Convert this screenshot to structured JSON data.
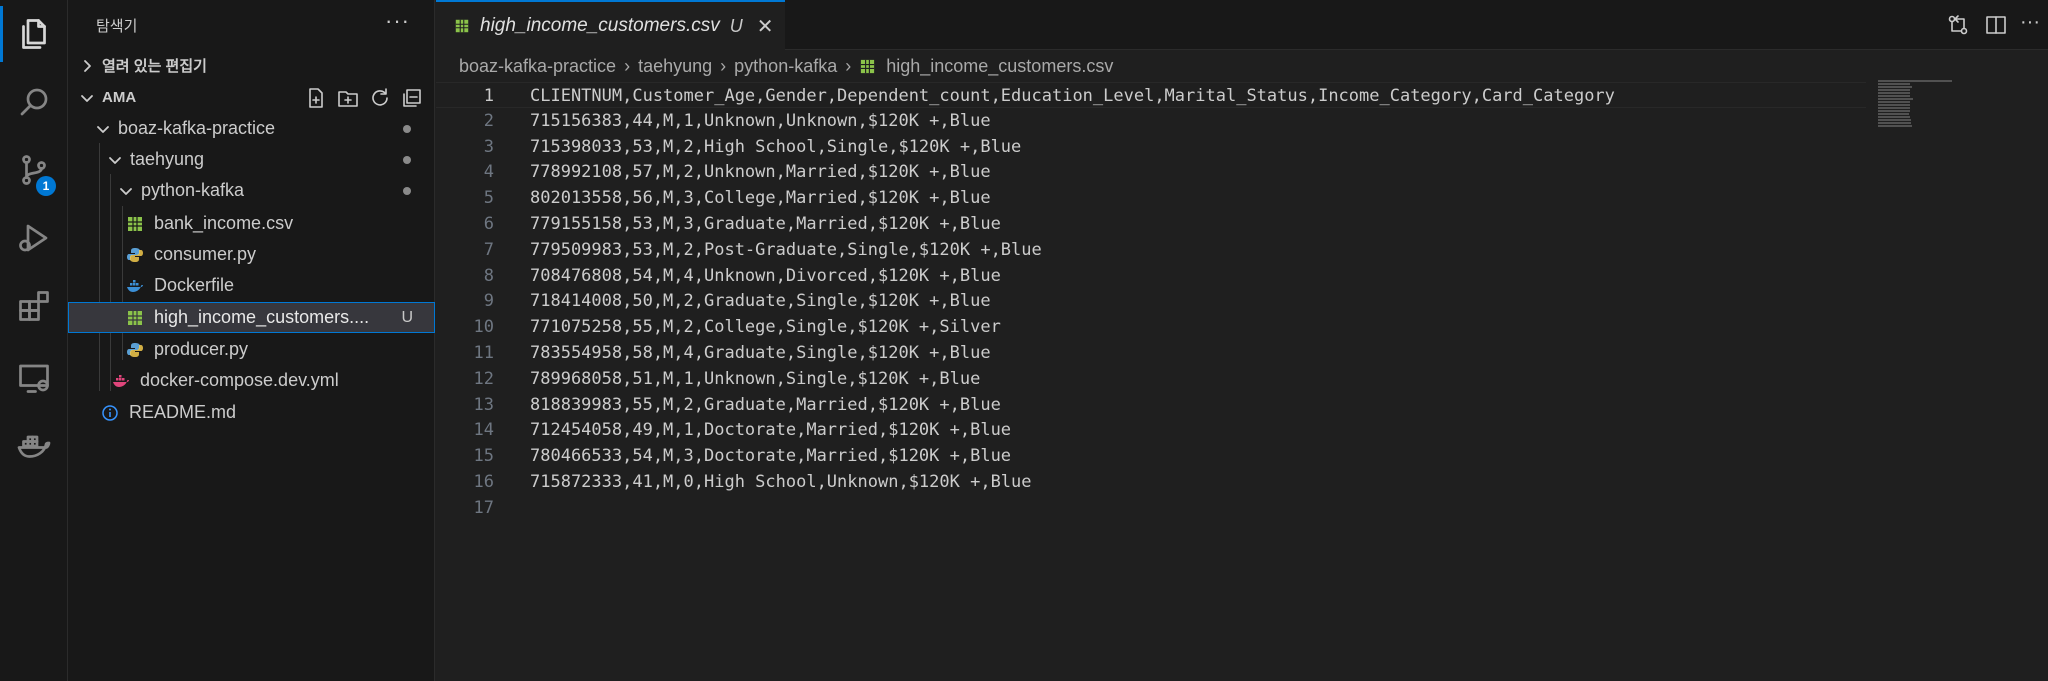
{
  "colors": {
    "accent": "#0078d4",
    "csv_icon": "#8bc34a",
    "python_icon": "#5a9fd4",
    "docker_icon": "#3b8fd6",
    "yaml_docker_icon": "#e0457b",
    "info_icon": "#3794ff"
  },
  "activity_bar": {
    "items": [
      {
        "name": "explorer-icon",
        "active": true
      },
      {
        "name": "search-icon"
      },
      {
        "name": "source-control-icon",
        "badge": "1"
      },
      {
        "name": "run-debug-icon"
      },
      {
        "name": "extensions-icon"
      },
      {
        "name": "remote-explorer-icon"
      },
      {
        "name": "docker-icon"
      }
    ]
  },
  "sidebar": {
    "title": "탐색기",
    "more": "···",
    "open_editors_label": "열려 있는 편집기",
    "workspace_label": "AMA",
    "tree": [
      {
        "label": "boaz-kafka-practice",
        "type": "folder",
        "depth": 1,
        "dot": true
      },
      {
        "label": "taehyung",
        "type": "folder",
        "depth": 2,
        "dot": true
      },
      {
        "label": "python-kafka",
        "type": "folder",
        "depth": 3,
        "dot": true
      },
      {
        "label": "bank_income.csv",
        "type": "csv",
        "depth": 4
      },
      {
        "label": "consumer.py",
        "type": "python",
        "depth": 4
      },
      {
        "label": "Dockerfile",
        "type": "docker",
        "depth": 4
      },
      {
        "label": "high_income_customers....",
        "type": "csv",
        "depth": 4,
        "selected": true,
        "badge": "U"
      },
      {
        "label": "producer.py",
        "type": "python",
        "depth": 4
      },
      {
        "label": "docker-compose.dev.yml",
        "type": "yaml",
        "depth": 3
      },
      {
        "label": "README.md",
        "type": "info",
        "depth": 2
      }
    ]
  },
  "tab": {
    "label": "high_income_customers.csv",
    "badge": "U",
    "close": "✕"
  },
  "breadcrumb": [
    "boaz-kafka-practice",
    "taehyung",
    "python-kafka",
    "high_income_customers.csv"
  ],
  "editor": {
    "current_line": 1,
    "lines": [
      "CLIENTNUM,Customer_Age,Gender,Dependent_count,Education_Level,Marital_Status,Income_Category,Card_Category",
      "715156383,44,M,1,Unknown,Unknown,$120K +,Blue",
      "715398033,53,M,2,High School,Single,$120K +,Blue",
      "778992108,57,M,2,Unknown,Married,$120K +,Blue",
      "802013558,56,M,3,College,Married,$120K +,Blue",
      "779155158,53,M,3,Graduate,Married,$120K +,Blue",
      "779509983,53,M,2,Post-Graduate,Single,$120K +,Blue",
      "708476808,54,M,4,Unknown,Divorced,$120K +,Blue",
      "718414008,50,M,2,Graduate,Single,$120K +,Blue",
      "771075258,55,M,2,College,Single,$120K +,Silver",
      "783554958,58,M,4,Graduate,Single,$120K +,Blue",
      "789968058,51,M,1,Unknown,Single,$120K +,Blue",
      "818839983,55,M,2,Graduate,Married,$120K +,Blue",
      "712454058,49,M,1,Doctorate,Married,$120K +,Blue",
      "780466533,54,M,3,Doctorate,Married,$120K +,Blue",
      "715872333,41,M,0,High School,Unknown,$120K +,Blue",
      ""
    ]
  }
}
